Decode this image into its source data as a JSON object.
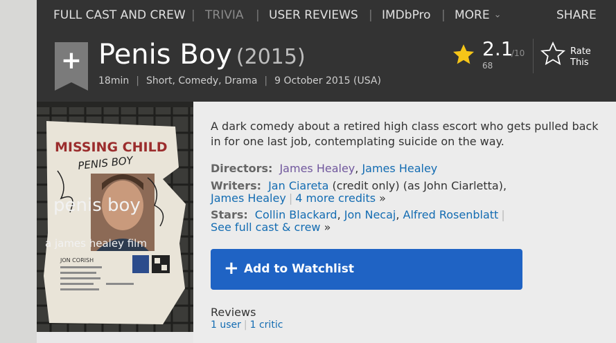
{
  "nav": {
    "items": [
      {
        "label": "FULL CAST AND CREW"
      },
      {
        "label": "TRIVIA"
      },
      {
        "label": "USER REVIEWS"
      },
      {
        "label": "IMDbPro"
      },
      {
        "label": "MORE"
      }
    ],
    "share": "SHARE"
  },
  "title": {
    "name": "Penis Boy",
    "year": "(2015)",
    "runtime": "18min",
    "genres": "Short, Comedy, Drama",
    "release": "9 October 2015 (USA)"
  },
  "rating": {
    "value": "2.1",
    "max": "/10",
    "count": "68",
    "rate_label_1": "Rate",
    "rate_label_2": "This"
  },
  "poster": {
    "line1": "MISSING CHILD",
    "line2": "penis boy",
    "line3": "a james healey film",
    "scrawl": "PENIS BOY",
    "card_name": "JON CORISH"
  },
  "summary": "A dark comedy about a retired high class escort who gets pulled back in for one last job, contemplating suicide on the way.",
  "directors": {
    "label": "Directors:",
    "names": [
      "James Healey",
      "James Healey"
    ]
  },
  "writers": {
    "label": "Writers:",
    "name1": "Jan Ciareta",
    "note1": "(credit only) (as John Ciarletta),",
    "name2": "James Healey",
    "more": "4 more credits",
    "arrow": "»"
  },
  "stars": {
    "label": "Stars:",
    "names": [
      "Collin Blackard",
      "Jon Necaj",
      "Alfred Rosenblatt"
    ],
    "see_all": "See full cast & crew",
    "arrow": "»"
  },
  "watchlist": {
    "label": "Add to Watchlist"
  },
  "reviews": {
    "title": "Reviews",
    "user": "1 user",
    "critic": "1 critic"
  },
  "colors": {
    "link": "#136cb2",
    "visited": "#70579d",
    "accent_star": "#f5c518",
    "watchlist": "#1f63c4"
  }
}
